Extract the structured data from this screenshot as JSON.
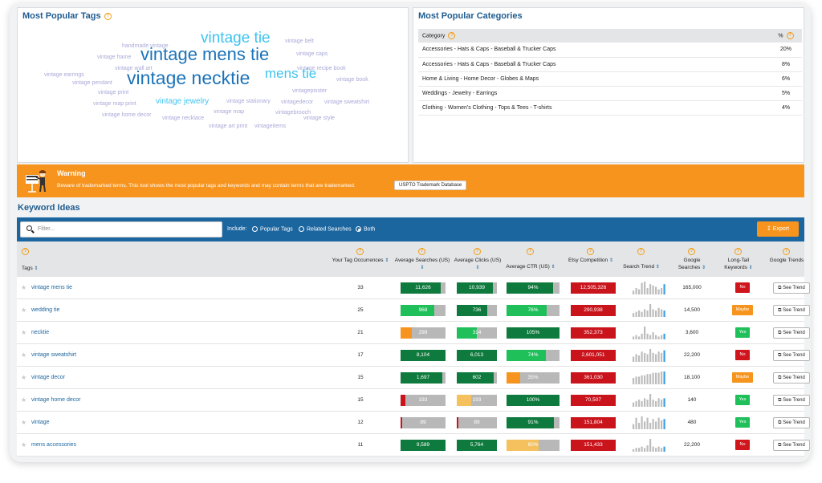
{
  "tags_panel": {
    "title": "Most Popular Tags",
    "cloud": [
      {
        "text": "handmade vintage",
        "size": 7,
        "color": "#a9a9d9"
      },
      {
        "text": "vintage tie",
        "size": 19,
        "color": "#3ec3f0"
      },
      {
        "text": "vintage belt",
        "size": 7,
        "color": "#a9a9d9"
      },
      {
        "text": "vintage frame",
        "size": 7,
        "color": "#a9a9d9"
      },
      {
        "text": "vintage mens tie",
        "size": 22,
        "color": "#1c73b8"
      },
      {
        "text": "vintage caps",
        "size": 7,
        "color": "#a9a9d9"
      },
      {
        "text": "vintage wall art",
        "size": 7,
        "color": "#a9a9d9"
      },
      {
        "text": "vintage recipe book",
        "size": 7,
        "color": "#a9a9d9"
      },
      {
        "text": "vintage earrings",
        "size": 7,
        "color": "#a9a9d9"
      },
      {
        "text": "mens tie",
        "size": 17,
        "color": "#3ec3f0"
      },
      {
        "text": "vintage pendant",
        "size": 7,
        "color": "#a9a9d9"
      },
      {
        "text": "vintage necktie",
        "size": 23,
        "color": "#1c73b8"
      },
      {
        "text": "vintage book",
        "size": 7,
        "color": "#a9a9d9"
      },
      {
        "text": "vintage print",
        "size": 7,
        "color": "#a9a9d9"
      },
      {
        "text": "vintagepixster",
        "size": 7,
        "color": "#a9a9d9"
      },
      {
        "text": "vintage map print",
        "size": 7,
        "color": "#a9a9d9"
      },
      {
        "text": "vintage jewelry",
        "size": 10,
        "color": "#3ec3f0"
      },
      {
        "text": "vintage stationary",
        "size": 7,
        "color": "#a9a9d9"
      },
      {
        "text": "vintagedecor",
        "size": 7,
        "color": "#a9a9d9"
      },
      {
        "text": "vintage sweatshirt",
        "size": 7,
        "color": "#a9a9d9"
      },
      {
        "text": "vintage map",
        "size": 7,
        "color": "#a9a9d9"
      },
      {
        "text": "vintagebrooch",
        "size": 7,
        "color": "#a9a9d9"
      },
      {
        "text": "vintage home decor",
        "size": 7,
        "color": "#a9a9d9"
      },
      {
        "text": "vintage necklace",
        "size": 7,
        "color": "#a9a9d9"
      },
      {
        "text": "vintage style",
        "size": 7,
        "color": "#a9a9d9"
      },
      {
        "text": "vintage art print",
        "size": 7,
        "color": "#a9a9d9"
      },
      {
        "text": "vintageitems",
        "size": 7,
        "color": "#a9a9d9"
      }
    ]
  },
  "categories_panel": {
    "title": "Most Popular Categories",
    "col_category": "Category",
    "col_pct": "%",
    "rows": [
      {
        "name": "Accessories - Hats & Caps - Baseball & Trucker Caps",
        "pct": "20%"
      },
      {
        "name": "Accessories - Hats & Caps - Baseball & Trucker Caps",
        "pct": "8%"
      },
      {
        "name": "Home & Living - Home Decor - Globes & Maps",
        "pct": "6%"
      },
      {
        "name": "Weddings - Jewelry - Earrings",
        "pct": "5%"
      },
      {
        "name": "Clothing - Women's Clothing - Tops & Tees - T-shirts",
        "pct": "4%"
      }
    ]
  },
  "warning": {
    "title": "Warning",
    "text": "Beware of trademarked terms. This tool shows the most popular tags and keywords and may contain terms that are trademarked.",
    "button": "USPTO Trademark Database"
  },
  "keyword_ideas": {
    "title": "Keyword Ideas",
    "search_placeholder": "Filter...",
    "include_label": "Include:",
    "options": [
      "Popular Tags",
      "Related Searches",
      "Both"
    ],
    "selected_option": "Both",
    "export_label": "Export",
    "headers": {
      "tags": "Tags",
      "occ": "Your Tag Occurrences",
      "searches": "Average Searches (US)",
      "clicks": "Average Clicks (US)",
      "ctr": "Average CTR (US)",
      "comp": "Etsy Competition",
      "trend": "Search Trend",
      "google": "Google Searches",
      "longtail": "Long-Tail Keywords",
      "gtrends": "Google Trends"
    },
    "see_trend_label": "See Trend",
    "rows": [
      {
        "tag": "vintage mens tie",
        "occ": "33",
        "searches": "11,626",
        "s_pct": 0.9,
        "s_col": "#0f7a3d",
        "clicks": "10,939",
        "c_pct": 0.9,
        "c_col": "#0f7a3d",
        "ctr": "94%",
        "ctr_pct": 0.88,
        "ctr_col": "#0f7a3d",
        "comp": "12,505,326",
        "comp_pct": 1.0,
        "google": "165,000",
        "lt": "No",
        "lt_col": "#d0151c",
        "spark": [
          3,
          5,
          4,
          9,
          10,
          5,
          8,
          7,
          6,
          4,
          5,
          8
        ]
      },
      {
        "tag": "wedding tie",
        "occ": "25",
        "searches": "968",
        "s_pct": 0.75,
        "s_col": "#1fbf5a",
        "clicks": "736",
        "c_pct": 0.75,
        "c_col": "#0f7a3d",
        "ctr": "76%",
        "ctr_pct": 0.76,
        "ctr_col": "#1fbf5a",
        "comp": "290,938",
        "comp_pct": 1.0,
        "google": "14,500",
        "lt": "Maybe",
        "lt_col": "#f7941d",
        "spark": [
          3,
          4,
          5,
          4,
          6,
          5,
          10,
          6,
          5,
          7,
          6,
          5
        ]
      },
      {
        "tag": "necktie",
        "occ": "21",
        "searches": "299",
        "s_pct": 0.25,
        "s_col": "#f7941d",
        "clicks": "314",
        "c_pct": 0.5,
        "c_col": "#1fbf5a",
        "ctr": "105%",
        "ctr_pct": 1.0,
        "ctr_col": "#0f7a3d",
        "comp": "352,373",
        "comp_pct": 1.0,
        "google": "3,600",
        "lt": "Yes",
        "lt_col": "#1fbf5a",
        "spark": [
          2,
          3,
          2,
          4,
          9,
          4,
          3,
          5,
          3,
          2,
          3,
          4
        ]
      },
      {
        "tag": "vintage sweatshirt",
        "occ": "17",
        "searches": "8,104",
        "s_pct": 1.0,
        "s_col": "#0f7a3d",
        "clicks": "6,013",
        "c_pct": 1.0,
        "c_col": "#0f7a3d",
        "ctr": "74%",
        "ctr_pct": 0.74,
        "ctr_col": "#1fbf5a",
        "comp": "2,601,051",
        "comp_pct": 1.0,
        "google": "22,200",
        "lt": "No",
        "lt_col": "#d0151c",
        "spark": [
          4,
          6,
          5,
          8,
          7,
          6,
          10,
          7,
          6,
          8,
          7,
          9
        ]
      },
      {
        "tag": "vintage decor",
        "occ": "15",
        "searches": "1,697",
        "s_pct": 0.92,
        "s_col": "#0f7a3d",
        "clicks": "602",
        "c_pct": 0.92,
        "c_col": "#0f7a3d",
        "ctr": "35%",
        "ctr_pct": 0.25,
        "ctr_col": "#f7941d",
        "comp": "361,030",
        "comp_pct": 1.0,
        "google": "18,100",
        "lt": "Maybe",
        "lt_col": "#f7941d",
        "spark": [
          5,
          6,
          6,
          7,
          7,
          8,
          8,
          9,
          9,
          9,
          10,
          10
        ]
      },
      {
        "tag": "vintage home decor",
        "occ": "15",
        "searches": "193",
        "s_pct": 0.1,
        "s_col": "#c9141c",
        "clicks": "193",
        "c_pct": 0.35,
        "c_col": "#f5c15e",
        "ctr": "100%",
        "ctr_pct": 1.0,
        "ctr_col": "#0f7a3d",
        "comp": "70,507",
        "comp_pct": 1.0,
        "google": "140",
        "lt": "Yes",
        "lt_col": "#1fbf5a",
        "spark": [
          3,
          4,
          5,
          4,
          6,
          5,
          9,
          5,
          4,
          6,
          5,
          6
        ]
      },
      {
        "tag": "vintage",
        "occ": "12",
        "searches": "89",
        "s_pct": 0.03,
        "s_col": "#c9141c",
        "clicks": "89",
        "c_pct": 0.03,
        "c_col": "#c9141c",
        "ctr": "91%",
        "ctr_pct": 0.9,
        "ctr_col": "#0f7a3d",
        "comp": "151,804",
        "comp_pct": 1.0,
        "google": "480",
        "lt": "Yes",
        "lt_col": "#1fbf5a",
        "spark": [
          4,
          9,
          5,
          10,
          6,
          9,
          5,
          8,
          6,
          9,
          7,
          8
        ]
      },
      {
        "tag": "mens accessories",
        "occ": "11",
        "searches": "9,589",
        "s_pct": 1.0,
        "s_col": "#0f7a3d",
        "clicks": "5,764",
        "c_pct": 1.0,
        "c_col": "#0f7a3d",
        "ctr": "60%",
        "ctr_pct": 0.6,
        "ctr_col": "#f5c15e",
        "comp": "151,433",
        "comp_pct": 1.0,
        "google": "22,200",
        "lt": "No",
        "lt_col": "#d0151c",
        "spark": [
          2,
          3,
          3,
          4,
          3,
          5,
          10,
          4,
          3,
          4,
          3,
          4
        ]
      }
    ]
  },
  "colors": {
    "accent": "#1c66a0",
    "warning": "#f7941d",
    "trend_last": "#3a9ee6"
  }
}
